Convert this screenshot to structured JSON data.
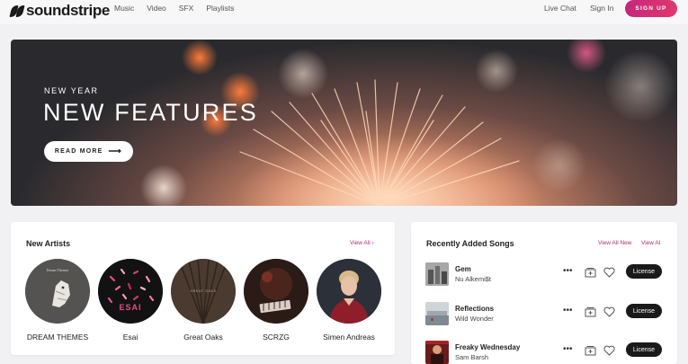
{
  "nav": {
    "logo_text": "soundstripe",
    "links": [
      "Music",
      "Video",
      "SFX",
      "Playlists"
    ],
    "live_chat": "Live Chat",
    "sign_in": "Sign In",
    "sign_up": "SIGN UP"
  },
  "hero": {
    "kicker": "NEW YEAR",
    "title": "NEW FEATURES",
    "button": "READ MORE",
    "button_arrow": "⟶"
  },
  "artists": {
    "title": "New Artists",
    "view_all": "View All ›",
    "items": [
      {
        "name": "DREAM THEMES",
        "image": "wolf-moon-illustration"
      },
      {
        "name": "Esai",
        "image": "esai-confetti-cover"
      },
      {
        "name": "Great Oaks",
        "image": "wood-grain-cover"
      },
      {
        "name": "SCRZG",
        "image": "dark-stage-cover"
      },
      {
        "name": "Simen Andreas",
        "image": "portrait-photo"
      }
    ]
  },
  "songs": {
    "title": "Recently Added Songs",
    "view_all_new": "View All New",
    "view_all": "View Al",
    "license_label": "License",
    "more_glyph": "•••",
    "items": [
      {
        "title": "Gem",
        "artist": "Nu Alkemi$t"
      },
      {
        "title": "Reflections",
        "artist": "Wild Wonder"
      },
      {
        "title": "Freaky Wednesday",
        "artist": "Sam Barsh"
      }
    ]
  },
  "colors": {
    "accent": "#c4267d",
    "button_dark": "#1a1a1a",
    "background": "#f1f1f3"
  }
}
